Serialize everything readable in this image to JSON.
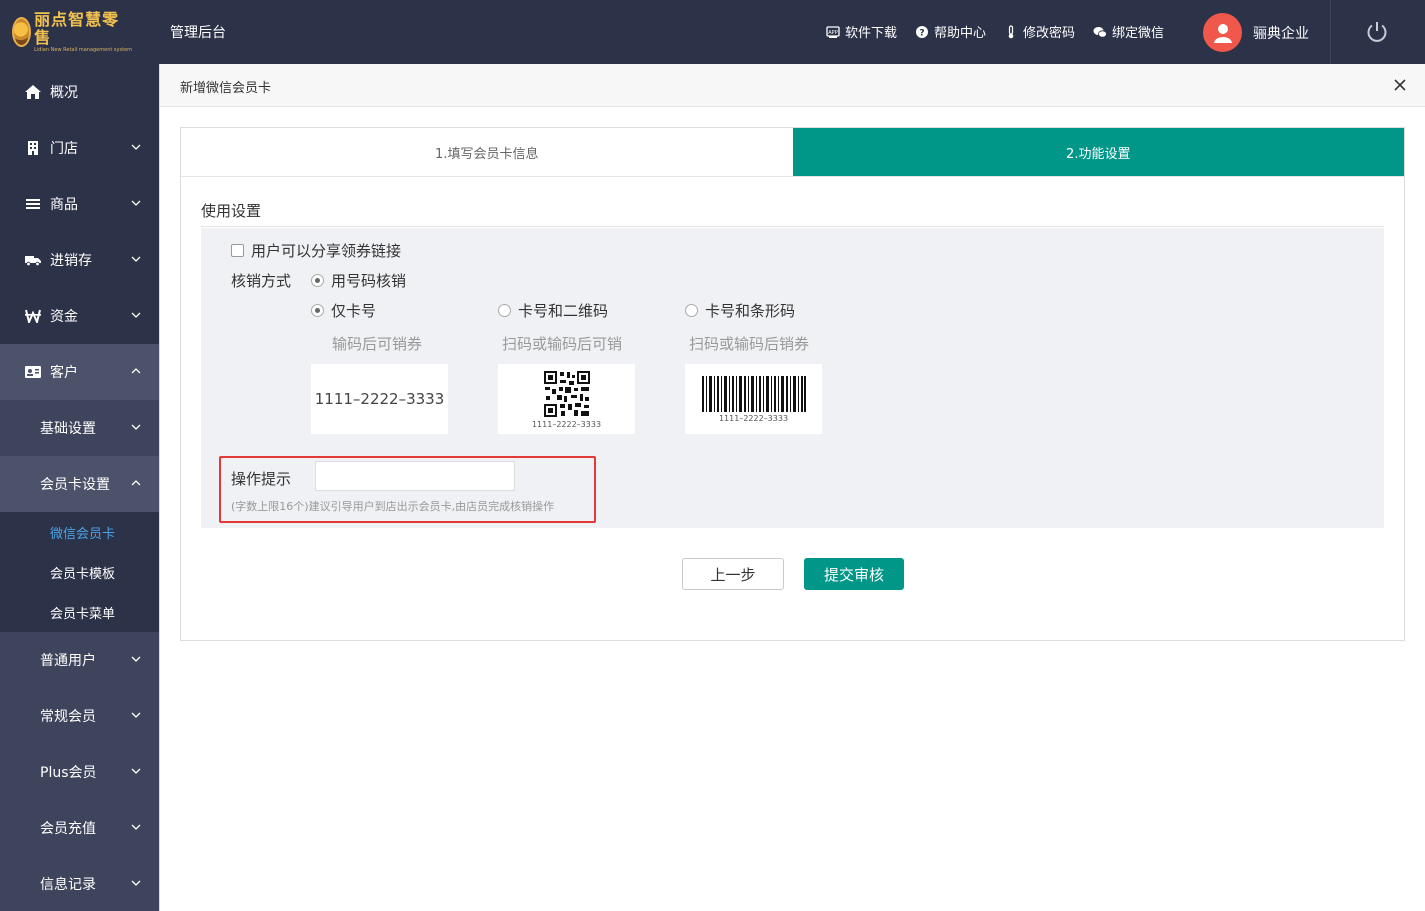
{
  "header": {
    "logo_text": "丽点智慧零售",
    "logo_sub": "Lidian New Retail management system",
    "admin_title": "管理后台",
    "links": [
      {
        "label": "软件下载",
        "icon": "download-icon"
      },
      {
        "label": "帮助中心",
        "icon": "help-icon"
      },
      {
        "label": "修改密码",
        "icon": "thermometer-icon"
      },
      {
        "label": "绑定微信",
        "icon": "wechat-icon"
      }
    ],
    "company": "骊典企业"
  },
  "sidebar": {
    "items": [
      {
        "label": "概况",
        "icon": "home-icon"
      },
      {
        "label": "门店",
        "icon": "store-icon"
      },
      {
        "label": "商品",
        "icon": "list-icon"
      },
      {
        "label": "进销存",
        "icon": "truck-icon"
      },
      {
        "label": "资金",
        "icon": "won-icon"
      },
      {
        "label": "客户",
        "icon": "idcard-icon"
      }
    ],
    "customer_sub": {
      "basic": "基础设置",
      "member_card": "会员卡设置",
      "leaves": [
        "微信会员卡",
        "会员卡模板",
        "会员卡菜单"
      ],
      "more": [
        "普通用户",
        "常规会员",
        "Plus会员",
        "会员充值",
        "信息记录"
      ]
    }
  },
  "dialog": {
    "title": "新增微信会员卡",
    "steps": [
      "1.填写会员卡信息",
      "2.功能设置"
    ],
    "section_title": "使用设置",
    "share_label": "用户可以分享领券链接",
    "method_label": "核销方式",
    "method_value": "用号码核销",
    "options": [
      {
        "label": "仅卡号",
        "desc": "输码后可销券",
        "card": "1111–2222–3333",
        "selected": true
      },
      {
        "label": "卡号和二维码",
        "desc": "扫码或输码后可销",
        "card": "1111–2222–3333",
        "selected": false
      },
      {
        "label": "卡号和条形码",
        "desc": "扫码或输码后销券",
        "card": "1111–2222–3333",
        "selected": false
      }
    ],
    "hint_label": "操作提示",
    "hint_value": "",
    "hint_placeholder": "",
    "hint_note": "(字数上限16个)建议引导用户到店出示会员卡,由店员完成核销操作",
    "btn_prev": "上一步",
    "btn_submit": "提交审核"
  },
  "colors": {
    "header_bg": "#2c3248",
    "accent": "#009688",
    "active_link": "#4aa3e8",
    "highlight": "#e53935"
  }
}
